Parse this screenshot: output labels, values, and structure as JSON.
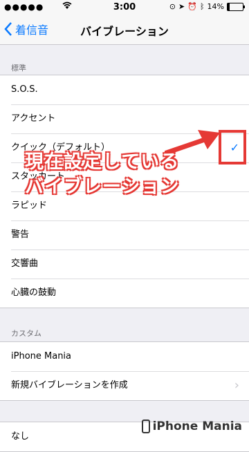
{
  "status": {
    "carrier": "●●●●●",
    "time": "3:00",
    "battery_text": "14%",
    "battery_level": 0.14
  },
  "nav": {
    "back_label": "着信音",
    "title": "バイブレーション"
  },
  "sections": {
    "standard_header": "標準",
    "standard_items": [
      "S.O.S.",
      "アクセント",
      "クイック（デフォルト）",
      "スタッカート",
      "ラピッド",
      "警告",
      "交響曲",
      "心臓の鼓動"
    ],
    "custom_header": "カスタム",
    "custom_items": [
      "iPhone Mania",
      "新規バイブレーションを作成"
    ],
    "none_item": "なし"
  },
  "annotation": {
    "line1": "現在設定している",
    "line2": "バイブレーション"
  },
  "brand": "iPhone Mania",
  "colors": {
    "accent": "#0a7aff",
    "annotation": "#e53935"
  }
}
